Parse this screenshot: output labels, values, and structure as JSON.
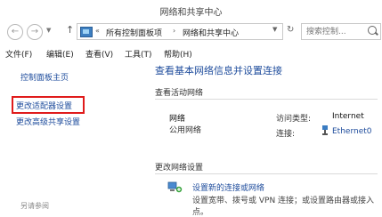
{
  "window": {
    "title": "网络和共享中心"
  },
  "address": {
    "root_sep": "«",
    "crumbs": [
      "所有控制面板项",
      "网络和共享中心"
    ],
    "crumb_sep": "›",
    "back_icon": "arrow-left-icon",
    "forward_icon": "arrow-right-icon",
    "up_icon": "arrow-up-icon",
    "refresh_icon": "refresh-icon"
  },
  "search": {
    "placeholder": "搜索控制..."
  },
  "menu": {
    "items": [
      "文件(F)",
      "编辑(E)",
      "查看(V)",
      "工具(T)",
      "帮助(H)"
    ]
  },
  "sidebar": {
    "links": [
      "控制面板主页",
      "更改适配器设置",
      "更改高级共享设置"
    ],
    "highlighted_index": 1,
    "highlight_color": "#e01b1b",
    "see_also": "另请参阅"
  },
  "main": {
    "heading": "查看基本网络信息并设置连接",
    "active_networks_title": "查看活动网络",
    "network": {
      "name": "网络",
      "type": "公用网络",
      "access_label": "访问类型:",
      "access_value": "Internet",
      "conn_label": "连接:",
      "conn_value": "Ethernet0"
    },
    "change_settings_title": "更改网络设置",
    "task": {
      "link": "设置新的连接或网络",
      "desc1": "设置宽带、拨号或 VPN 连接；或设置路由器或接入",
      "desc2": "点。"
    }
  },
  "colors": {
    "link": "#1e4c9c",
    "highlight": "#e01b1b"
  }
}
